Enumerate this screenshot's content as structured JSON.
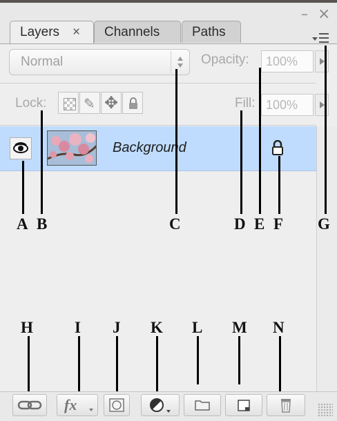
{
  "panel": {
    "tabs": [
      {
        "label": "Layers",
        "active": true
      },
      {
        "label": "Channels",
        "active": false
      },
      {
        "label": "Paths",
        "active": false
      }
    ]
  },
  "controls": {
    "blend_mode": "Normal",
    "opacity_label": "Opacity:",
    "opacity_value": "100%",
    "lock_label": "Lock:",
    "fill_label": "Fill:",
    "fill_value": "100%"
  },
  "layers": [
    {
      "name": "Background",
      "visible": true,
      "locked": true
    }
  ],
  "callouts": {
    "a": "A",
    "b": "B",
    "c": "C",
    "d": "D",
    "e": "E",
    "f": "F",
    "g": "G",
    "h": "H",
    "i": "I",
    "j": "J",
    "k": "K",
    "l": "L",
    "m": "M",
    "n": "N"
  },
  "bottom_bar": {
    "fx_label": "fx",
    "icons": [
      "link-layers-icon",
      "layer-style-icon",
      "layer-mask-icon",
      "adjustment-layer-icon",
      "new-group-icon",
      "new-layer-icon",
      "delete-layer-icon"
    ]
  },
  "colors": {
    "panel_bg": "#eeeeee",
    "selected_layer_bg": "#bfdcff",
    "callout_line": "#000000"
  }
}
